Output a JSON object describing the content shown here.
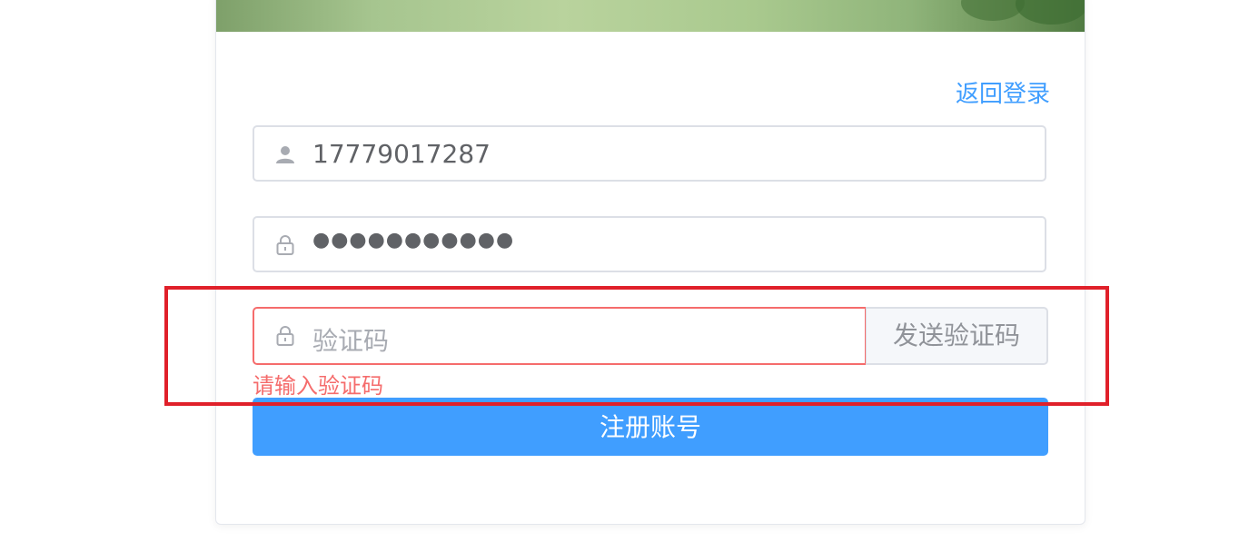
{
  "form": {
    "back_link": "返回登录",
    "phone_value": "17779017287",
    "password_mask": "●●●●●●●●●●●",
    "code_placeholder": "验证码",
    "send_code_label": "发送验证码",
    "code_error": "请输入验证码",
    "submit_label": "注册账号"
  },
  "icons": {
    "phone": "user-icon",
    "password": "lock-icon",
    "code": "lock-icon"
  },
  "colors": {
    "primary": "#409eff",
    "error": "#f56c6c",
    "highlight": "#e0202a"
  }
}
